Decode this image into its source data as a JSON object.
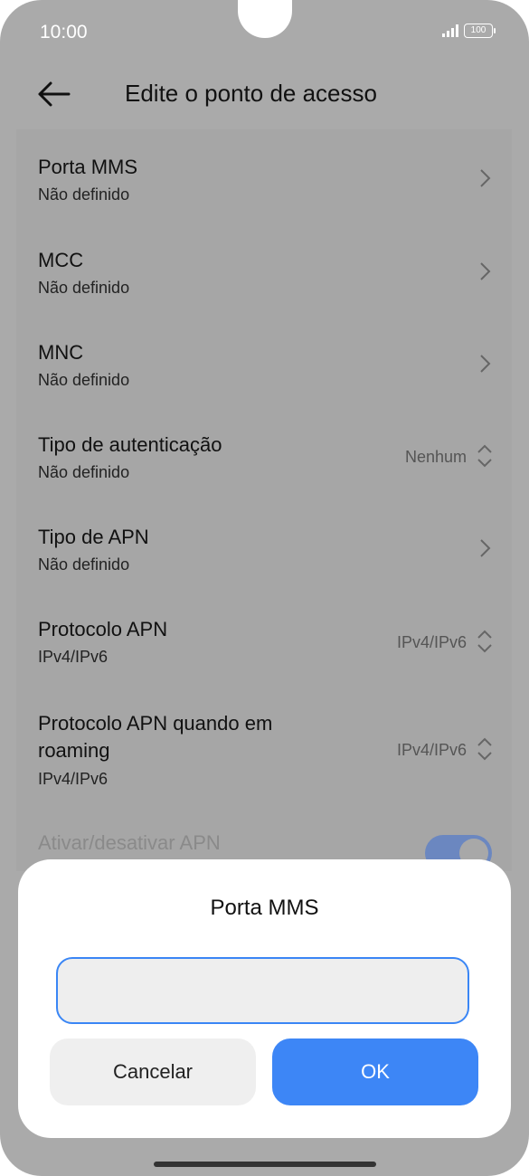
{
  "status_bar": {
    "time": "10:00",
    "battery": "100",
    "icons": [
      "signal-icon",
      "battery-icon"
    ]
  },
  "header": {
    "title": "Edite o ponto de acesso",
    "back_icon": "arrow-left-icon"
  },
  "settings": {
    "items": [
      {
        "title": "Porta MMS",
        "subtitle": "Não definido",
        "control": "chevron-right-icon"
      },
      {
        "title": "MCC",
        "subtitle": "Não definido",
        "control": "chevron-right-icon"
      },
      {
        "title": "MNC",
        "subtitle": "Não definido",
        "control": "chevron-right-icon"
      },
      {
        "title": "Tipo de autenticação",
        "subtitle": "Não definido",
        "value": "Nenhum",
        "control": "updown-icon"
      },
      {
        "title": "Tipo de APN",
        "subtitle": "Não definido",
        "control": "chevron-right-icon"
      },
      {
        "title": "Protocolo APN",
        "subtitle": "IPv4/IPv6",
        "value": "IPv4/IPv6",
        "control": "updown-icon"
      },
      {
        "title_line1": "Protocolo APN quando em",
        "title_line2": "roaming",
        "subtitle": "IPv4/IPv6",
        "value": "IPv4/IPv6",
        "control": "updown-icon"
      },
      {
        "title": "Ativar/desativar APN",
        "toggle_on": true,
        "disabled": true
      }
    ]
  },
  "dialog": {
    "title": "Porta MMS",
    "input_value": "",
    "cancel_label": "Cancelar",
    "ok_label": "OK"
  },
  "colors": {
    "accent": "#3d86f6",
    "scrim": "#aaaaaa",
    "dialog_bg": "#ffffff"
  }
}
